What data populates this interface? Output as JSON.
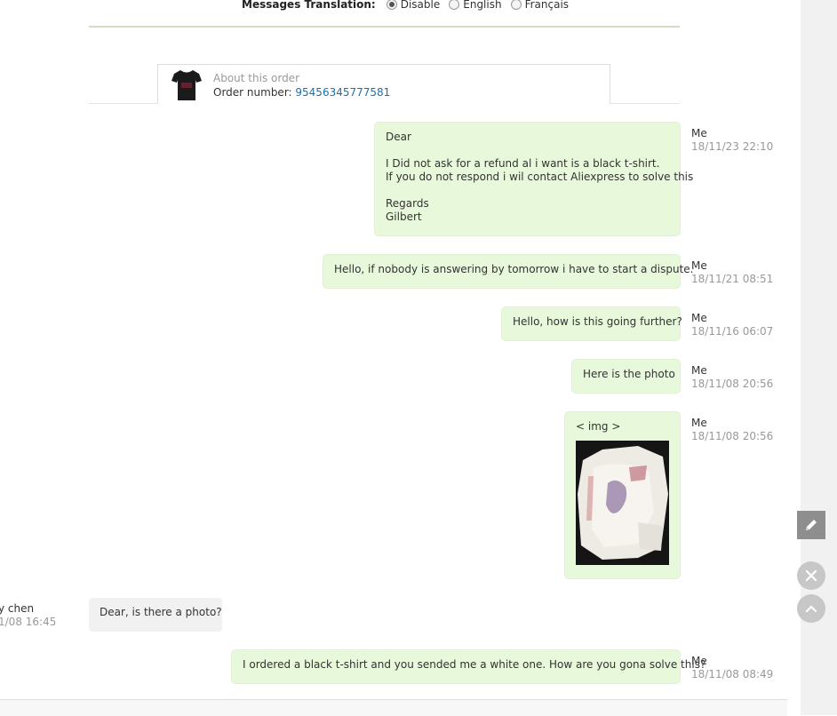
{
  "translation": {
    "label": "Messages Translation:",
    "options": [
      "Disable",
      "English",
      "Français"
    ],
    "selected": "Disable"
  },
  "order": {
    "about_label": "About this order",
    "number_label": "Order number: ",
    "number": "95456345777581"
  },
  "messages": [
    {
      "sender": "Me",
      "time": "18/11/23 22:10",
      "lines": [
        "Dear",
        "",
        "I Did not ask for a refund al i want is a black t-shirt.",
        "If you do not respond i wil contact Aliexpress to solve this",
        "",
        "Regards",
        "Gilbert"
      ]
    },
    {
      "sender": "Me",
      "time": "18/11/21 08:51",
      "lines": [
        "Hello, if nobody is answering by tomorrow i have to start a dispute."
      ]
    },
    {
      "sender": "Me",
      "time": "18/11/16 06:07",
      "lines": [
        "Hello, how is this going further?"
      ]
    },
    {
      "sender": "Me",
      "time": "18/11/08 20:56",
      "lines": [
        "Here is the photo"
      ]
    },
    {
      "sender": "Me",
      "time": "18/11/08 20:56",
      "lines": [
        "< img >"
      ]
    },
    {
      "sender": "y chen",
      "time": "1/08 16:45",
      "lines": [
        "Dear, is there a photo?"
      ]
    },
    {
      "sender": "Me",
      "time": "18/11/08 08:49",
      "lines": [
        "I ordered a black t-shirt and you sended me a white one. How are you gona solve this?"
      ]
    }
  ],
  "colors": {
    "me_bubble": "#e8f8db",
    "other_bubble": "#f1f1f1",
    "link": "#1f6fa5"
  },
  "icons": {
    "edit": "pencil-icon",
    "close": "close-icon",
    "scroll_top": "chevron-up-icon"
  }
}
